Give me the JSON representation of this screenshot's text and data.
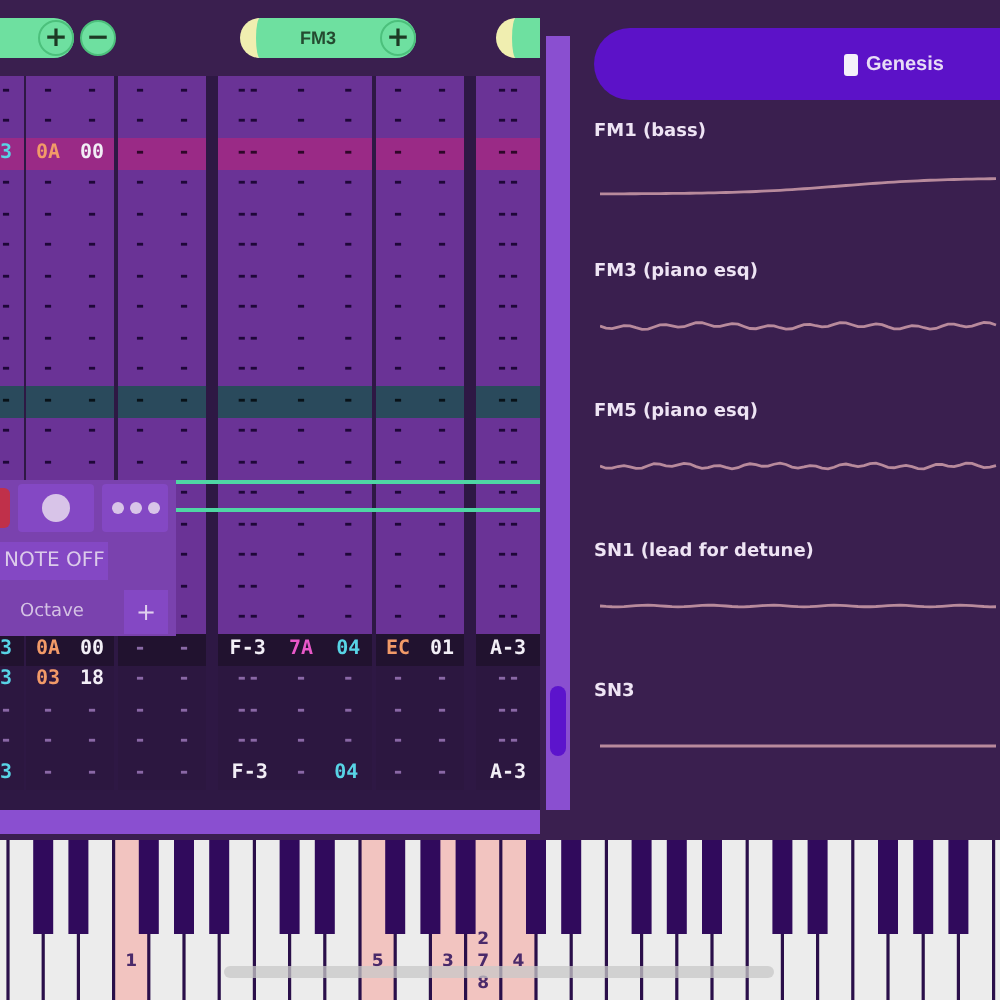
{
  "channel_headers": [
    {
      "kind": "cut",
      "buttons": [
        "+",
        "−"
      ]
    },
    {
      "kind": "full",
      "name": "FM3",
      "buttons": [
        "+"
      ]
    },
    {
      "kind": "stub"
    }
  ],
  "rows": [
    {
      "kind": "normal",
      "cells": [
        "-",
        "-",
        "-",
        "-",
        "-",
        "--",
        "-",
        "-",
        "-",
        "-",
        "--"
      ]
    },
    {
      "kind": "normal",
      "cells": [
        "-",
        "-",
        "-",
        "-",
        "-",
        "--",
        "-",
        "-",
        "-",
        "-",
        "--"
      ]
    },
    {
      "kind": "highlight",
      "cells": [
        "3",
        "0A",
        "00",
        "-",
        "-",
        "--",
        "-",
        "-",
        "-",
        "-",
        "--"
      ]
    },
    {
      "kind": "normal",
      "cells": [
        "-",
        "-",
        "-",
        "-",
        "-",
        "--",
        "-",
        "-",
        "-",
        "-",
        "--"
      ]
    },
    {
      "kind": "normal",
      "cells": [
        "-",
        "-",
        "-",
        "-",
        "-",
        "--",
        "-",
        "-",
        "-",
        "-",
        "--"
      ]
    },
    {
      "kind": "normal",
      "cells": [
        "-",
        "-",
        "-",
        "-",
        "-",
        "--",
        "-",
        "-",
        "-",
        "-",
        "--"
      ]
    },
    {
      "kind": "normal",
      "cells": [
        "-",
        "-",
        "-",
        "-",
        "-",
        "--",
        "-",
        "-",
        "-",
        "-",
        "--"
      ]
    },
    {
      "kind": "normal",
      "cells": [
        "-",
        "-",
        "-",
        "-",
        "-",
        "--",
        "-",
        "-",
        "-",
        "-",
        "--"
      ]
    },
    {
      "kind": "normal",
      "cells": [
        "-",
        "-",
        "-",
        "-",
        "-",
        "--",
        "-",
        "-",
        "-",
        "-",
        "--"
      ]
    },
    {
      "kind": "normal",
      "cells": [
        "-",
        "-",
        "-",
        "-",
        "-",
        "--",
        "-",
        "-",
        "-",
        "-",
        "--"
      ]
    },
    {
      "kind": "beat",
      "cells": [
        "-",
        "-",
        "-",
        "-",
        "-",
        "--",
        "-",
        "-",
        "-",
        "-",
        "--"
      ]
    },
    {
      "kind": "normal",
      "cells": [
        "-",
        "-",
        "-",
        "-",
        "-",
        "--",
        "-",
        "-",
        "-",
        "-",
        "--"
      ]
    },
    {
      "kind": "normal",
      "cells": [
        "-",
        "-",
        "-",
        "-",
        "-",
        "--",
        "-",
        "-",
        "-",
        "-",
        "--"
      ]
    },
    {
      "kind": "normal",
      "cells": [
        null,
        null,
        null,
        null,
        "-",
        "--",
        "-",
        "-",
        "-",
        "-",
        "--"
      ]
    },
    {
      "kind": "normal",
      "cells": [
        null,
        null,
        null,
        null,
        "-",
        "--",
        "-",
        "-",
        "-",
        "-",
        "--"
      ]
    },
    {
      "kind": "normal",
      "cells": [
        null,
        null,
        null,
        null,
        "-",
        "--",
        "-",
        "-",
        "-",
        "-",
        "--"
      ]
    },
    {
      "kind": "normal",
      "cells": [
        null,
        null,
        null,
        null,
        "-",
        "--",
        "-",
        "-",
        "-",
        "-",
        "--"
      ]
    },
    {
      "kind": "normal",
      "cells": [
        null,
        null,
        null,
        null,
        "-",
        "--",
        "-",
        "-",
        "-",
        "-",
        "--"
      ]
    },
    {
      "kind": "current",
      "cells": [
        "3",
        "0A",
        "00",
        "-",
        "-",
        "F-3",
        "7A",
        "04",
        "EC",
        "01",
        "A-3"
      ]
    },
    {
      "kind": "past",
      "cells": [
        "3",
        "03",
        "18",
        "-",
        "-",
        "--",
        "-",
        "-",
        "-",
        "-",
        "--"
      ]
    },
    {
      "kind": "past",
      "cells": [
        "-",
        "-",
        "-",
        "-",
        "-",
        "--",
        "-",
        "-",
        "-",
        "-",
        "--"
      ]
    },
    {
      "kind": "past",
      "cells": [
        "-",
        "-",
        "-",
        "-",
        "-",
        "--",
        "-",
        "-",
        "-",
        "-",
        "--"
      ]
    },
    {
      "kind": "past",
      "cells": [
        "3",
        "-",
        "-",
        "-",
        "-",
        "F-3",
        "-",
        "04",
        "-",
        "-",
        "A-3"
      ]
    }
  ],
  "overlay": {
    "note_off_label": "NOTE OFF",
    "octave_label": "Octave",
    "add_button": "+"
  },
  "preset_button": {
    "label": "Genesis"
  },
  "instruments": [
    {
      "name": "FM1 (bass)"
    },
    {
      "name": "FM3 (piano esq)"
    },
    {
      "name": "FM5 (piano esq)"
    },
    {
      "name": "SN1 (lead for detune)"
    },
    {
      "name": "SN3"
    }
  ],
  "piano": {
    "white_keys": [
      {
        "pressed": false
      },
      {
        "pressed": false
      },
      {
        "pressed": false
      },
      {
        "pressed": false
      },
      {
        "pressed": true,
        "labels": [
          "1"
        ]
      },
      {
        "pressed": false
      },
      {
        "pressed": false
      },
      {
        "pressed": false
      },
      {
        "pressed": false
      },
      {
        "pressed": false
      },
      {
        "pressed": false
      },
      {
        "pressed": true,
        "labels": [
          "5"
        ]
      },
      {
        "pressed": false
      },
      {
        "pressed": true,
        "labels": [
          "3"
        ]
      },
      {
        "pressed": true,
        "labels": [
          "2",
          "7",
          "8"
        ]
      },
      {
        "pressed": true,
        "labels": [
          "4"
        ]
      },
      {
        "pressed": false
      },
      {
        "pressed": false
      },
      {
        "pressed": false
      },
      {
        "pressed": false
      },
      {
        "pressed": false
      },
      {
        "pressed": false
      },
      {
        "pressed": false
      },
      {
        "pressed": false
      },
      {
        "pressed": false
      },
      {
        "pressed": false
      },
      {
        "pressed": false
      },
      {
        "pressed": false
      },
      {
        "pressed": false
      },
      {
        "pressed": false
      }
    ]
  }
}
